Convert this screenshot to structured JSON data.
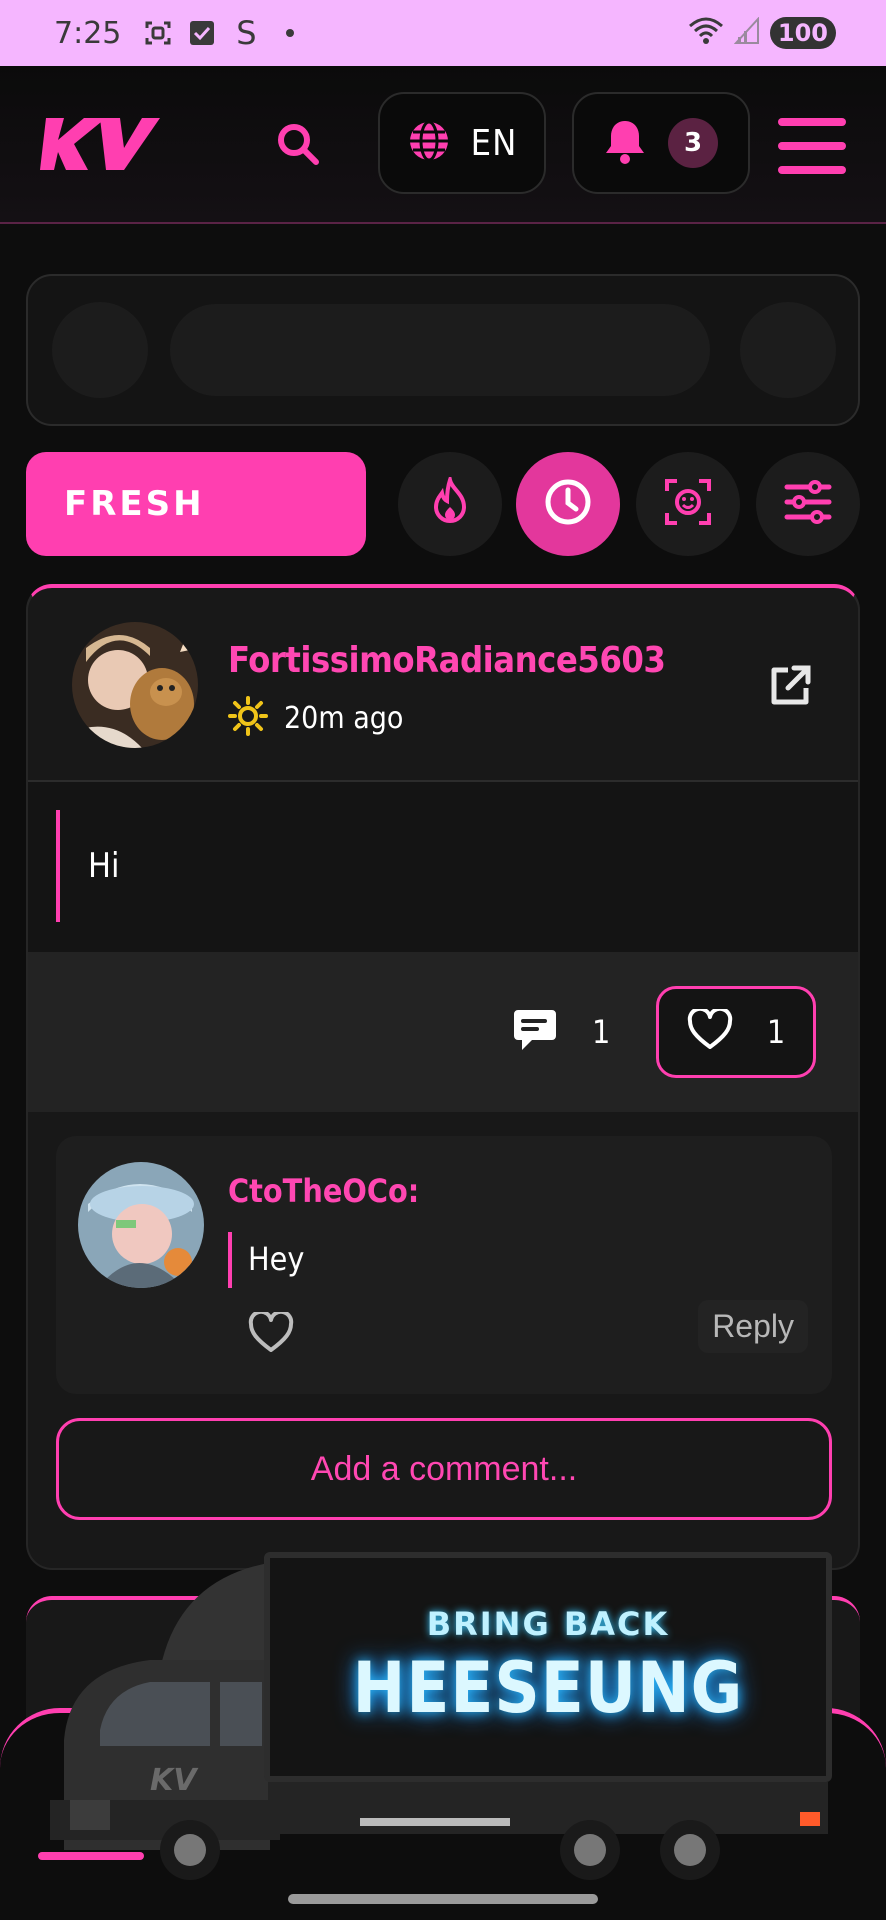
{
  "status_bar": {
    "time": "7:25",
    "s_icon": "S",
    "battery": "100"
  },
  "header": {
    "logo": "KV",
    "language": "EN",
    "notification_count": "3"
  },
  "filters": {
    "fresh_label": "FRESH"
  },
  "post": {
    "username": "FortissimoRadiance5603",
    "time": "20m ago",
    "text": "Hi",
    "comment_count": "1",
    "like_count": "1"
  },
  "comment": {
    "username": "CtoTheOCo:",
    "text": "Hey",
    "reply_label": "Reply"
  },
  "add_comment_label": "Add a comment...",
  "banner": {
    "top": "BRING BACK",
    "main": "HEESEUNG"
  },
  "colors": {
    "accent": "#ff3fb0",
    "status_bar": "#f5b6ff",
    "background": "#0d0d0d"
  }
}
